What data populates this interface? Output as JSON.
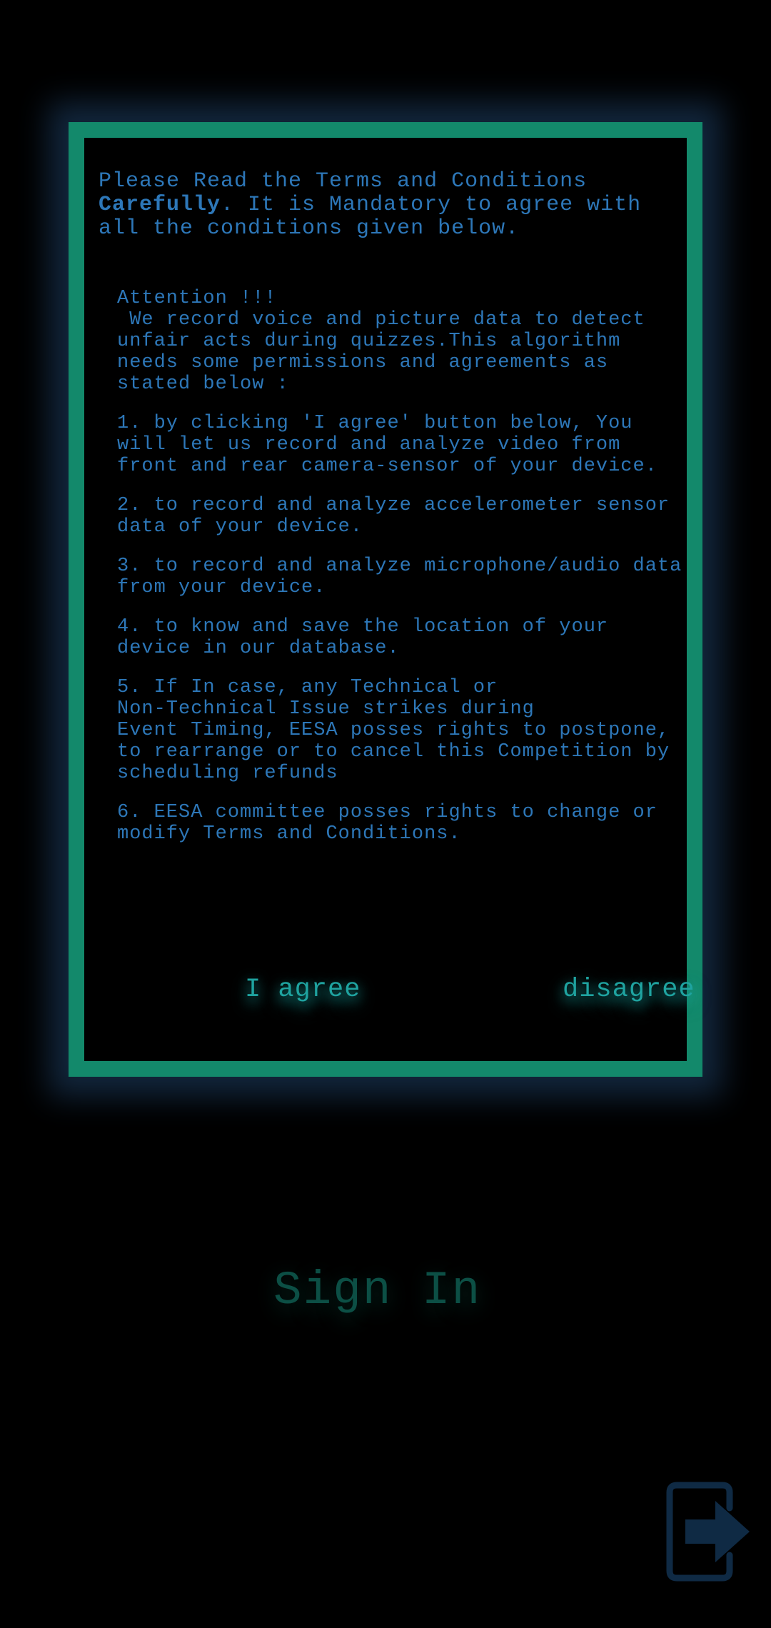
{
  "terms_dialog": {
    "intro_part1": "Please Read the Terms and Conditions ",
    "intro_bold": "Carefully",
    "intro_part2": ". It is Mandatory to agree with all the conditions given below.",
    "attention_title": "Attention !!!",
    "attention_body": " We record voice and picture data to detect unfair acts during quizzes.This algorithm needs some permissions and agreements as stated below :",
    "items": [
      "1. by clicking 'I agree' button below, You will let us record and analyze video from front and rear camera-sensor of your device.",
      "2. to record and analyze accelerometer sensor data of your device.",
      "3. to record and analyze microphone/audio data from your device.",
      "4. to know and save the location of your device in our database.",
      "5. If In case, any Technical or\nNon-Technical Issue strikes during\nEvent Timing, EESA posses rights to postpone, to rearrange or to cancel this Competition by scheduling refunds",
      "6. EESA committee posses rights to change or modify Terms and Conditions."
    ],
    "agree_label": "I agree",
    "disagree_label": "disagree"
  },
  "signin_label": "Sign In",
  "icons": {
    "exit": "logout-icon"
  },
  "colors": {
    "border": "#13896b",
    "text": "#2d77b8",
    "button": "#1fa3a0",
    "signin": "#0c4f45",
    "exit_icon": "#0f2a44"
  }
}
